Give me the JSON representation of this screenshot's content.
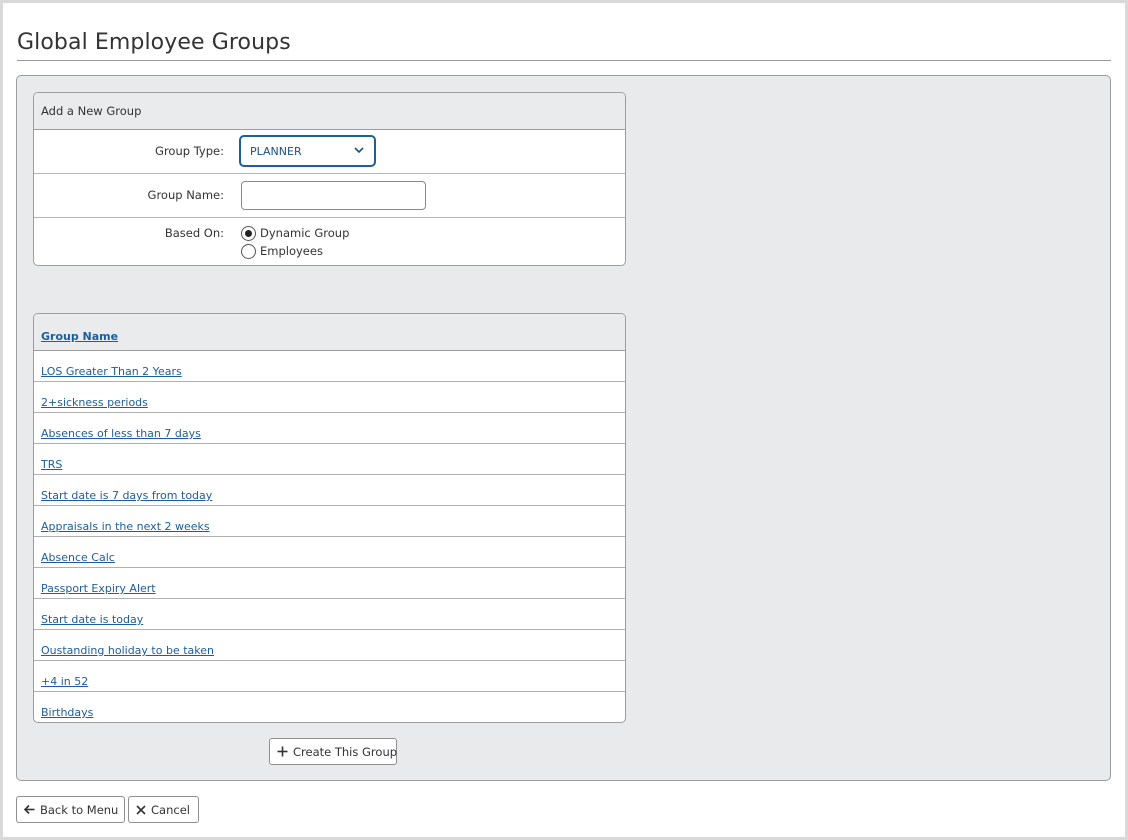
{
  "page": {
    "title": "Global Employee Groups"
  },
  "form": {
    "header": "Add a New Group",
    "group_type": {
      "label": "Group Type:",
      "value": "PLANNER"
    },
    "group_name": {
      "label": "Group Name:",
      "value": "",
      "placeholder": ""
    },
    "based_on": {
      "label": "Based On:",
      "options": [
        {
          "label": "Dynamic Group",
          "checked": true
        },
        {
          "label": "Employees",
          "checked": false
        }
      ]
    }
  },
  "groups": {
    "header": "Group Name",
    "rows": [
      "LOS Greater Than 2 Years",
      "2+sickness periods",
      "Absences of less than 7 days",
      "TRS",
      "Start date is 7 days from today",
      "Appraisals in the next 2 weeks",
      "Absence Calc",
      "Passport Expiry Alert",
      "Start date is today",
      "Oustanding holiday to be taken",
      "+4 in 52",
      "Birthdays"
    ]
  },
  "actions": {
    "create_label": "Create This Group",
    "back_label": "Back to Menu",
    "cancel_label": "Cancel"
  },
  "icons": {
    "select": "chevron-down-icon",
    "create": "plus-icon",
    "back": "arrow-left-icon",
    "cancel": "close-icon"
  },
  "colors": {
    "link": "#1d5d99",
    "select_border": "#1d5f99",
    "panel_bg": "#e9eaeb"
  }
}
